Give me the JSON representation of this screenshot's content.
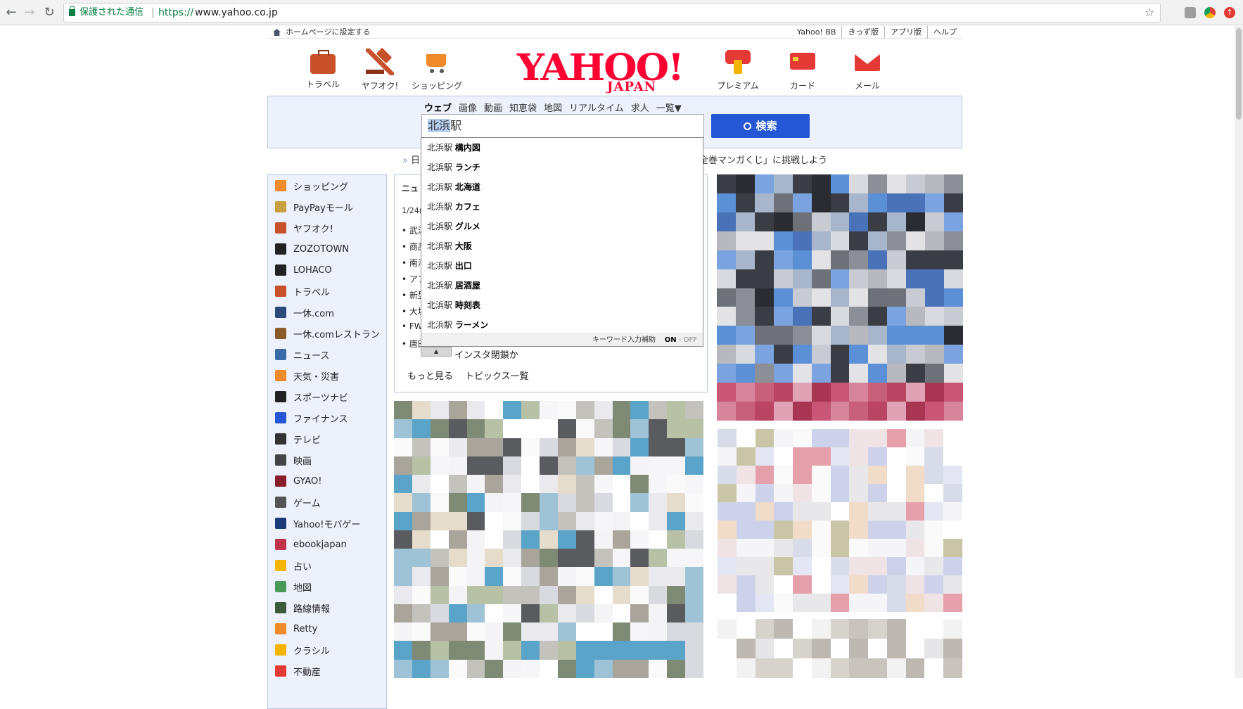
{
  "browser": {
    "secure_label": "保護された通信",
    "url_scheme": "https://",
    "url_host": "www.yahoo.co.jp"
  },
  "top_links": {
    "set_home": "ホームページに設定する",
    "links": [
      "Yahoo! BB",
      "きっず版",
      "アプリ版",
      "ヘルプ"
    ]
  },
  "services_left": [
    "トラベル",
    "ヤフオク!",
    "ショッピング"
  ],
  "services_right": [
    "プレミアム",
    "カード",
    "メール"
  ],
  "logo": {
    "main": "YAHOO!",
    "sub": "JAPAN"
  },
  "search": {
    "tabs": [
      "ウェブ",
      "画像",
      "動画",
      "知恵袋",
      "地図",
      "リアルタイム",
      "求人",
      "一覧▼"
    ],
    "active_tab": "ウェブ",
    "query_selected": "北浜",
    "query_rest": "駅",
    "button_label": "検索"
  },
  "suggest": {
    "query": "北浜駅",
    "completions": [
      "構内図",
      "ランチ",
      "北海道",
      "カフェ",
      "グルメ",
      "大阪",
      "出口",
      "居酒屋",
      "時刻表",
      "ラーメン"
    ],
    "footer_label": "キーワード入力補助",
    "on_label": "ON",
    "sep": " - ",
    "off_label": "OFF",
    "collapse": "▲"
  },
  "notice": {
    "lead": "日",
    "tail": "全巻マンガくじ」に挑戦しよう"
  },
  "news": {
    "head": "ニュ",
    "date": "1/24(",
    "rows": [
      "• 武漢",
      "• 商品",
      "• 南海",
      "• アプ",
      "• 新型",
      "• 大坂",
      "• FW",
      "• 唐田"
    ],
    "trail": "インスタ閉鎖か",
    "more": "もっと見る",
    "list": "トピックス一覧"
  },
  "sidebar": {
    "items": [
      "ショッピング",
      "PayPayモール",
      "ヤフオク!",
      "ZOZOTOWN",
      "LOHACO",
      "トラベル",
      "一休.com",
      "一休.comレストラン",
      "ニュース",
      "天気・災害",
      "スポーツナビ",
      "ファイナンス",
      "テレビ",
      "映画",
      "GYAO!",
      "ゲーム",
      "Yahoo!モバゲー",
      "ebookjapan",
      "占い",
      "地図",
      "路線情報",
      "Retty",
      "クラシル",
      "不動産"
    ],
    "icon_colors": [
      "#f08a2b",
      "#c8a040",
      "#c8502a",
      "#222222",
      "#222222",
      "#c8502a",
      "#2b4a7a",
      "#8a5a2a",
      "#3a6aa8",
      "#f08a2b",
      "#222222",
      "#2456d6",
      "#333333",
      "#444444",
      "#8a1d2a",
      "#555555",
      "#1a3a7a",
      "#c0334a",
      "#f4b400",
      "#4a9a5a",
      "#3a5a3a",
      "#f08a2b",
      "#f4b400",
      "#e53935"
    ]
  }
}
